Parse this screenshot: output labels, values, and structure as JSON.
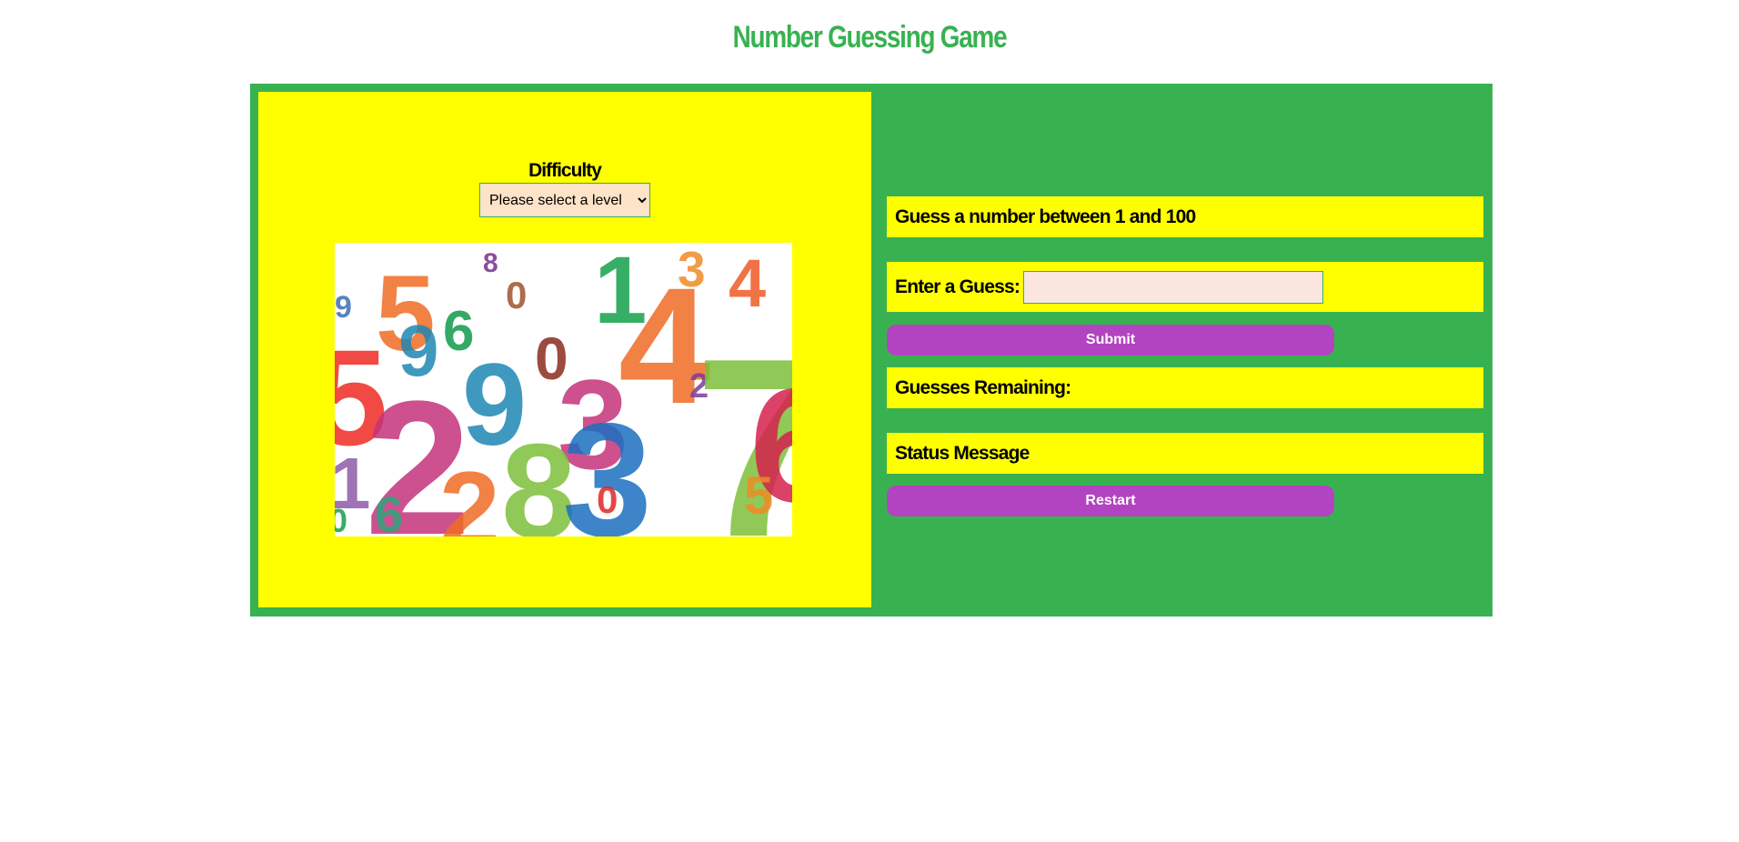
{
  "header": {
    "title": "Number Guessing Game"
  },
  "settings": {
    "difficulty_label": "Difficulty",
    "difficulty_select": {
      "selected": "Please select a level",
      "options": [
        "Please select a level"
      ]
    }
  },
  "illustration": {
    "name": "colorful-numbers-image",
    "digits": [
      "8",
      "1",
      "3",
      "9",
      "5",
      "6",
      "0",
      "4",
      "4",
      "5",
      "0",
      "9",
      "3",
      "2",
      "7",
      "6",
      "1",
      "2",
      "8",
      "3",
      "2",
      "0",
      "0",
      "6",
      "5",
      "9"
    ]
  },
  "game": {
    "prompt": "Guess a number between 1 and 100",
    "guess_label": "Enter a Guess:",
    "guess_value": "",
    "submit_label": "Submit",
    "remaining_label": "Guesses Remaining:",
    "status_label": "Status Message",
    "restart_label": "Restart"
  },
  "colors": {
    "brand_green": "#38b250",
    "panel_yellow": "#ffff00",
    "button_purple": "#b344c1",
    "select_background": "#fde3c7",
    "input_background": "#fae6de"
  }
}
